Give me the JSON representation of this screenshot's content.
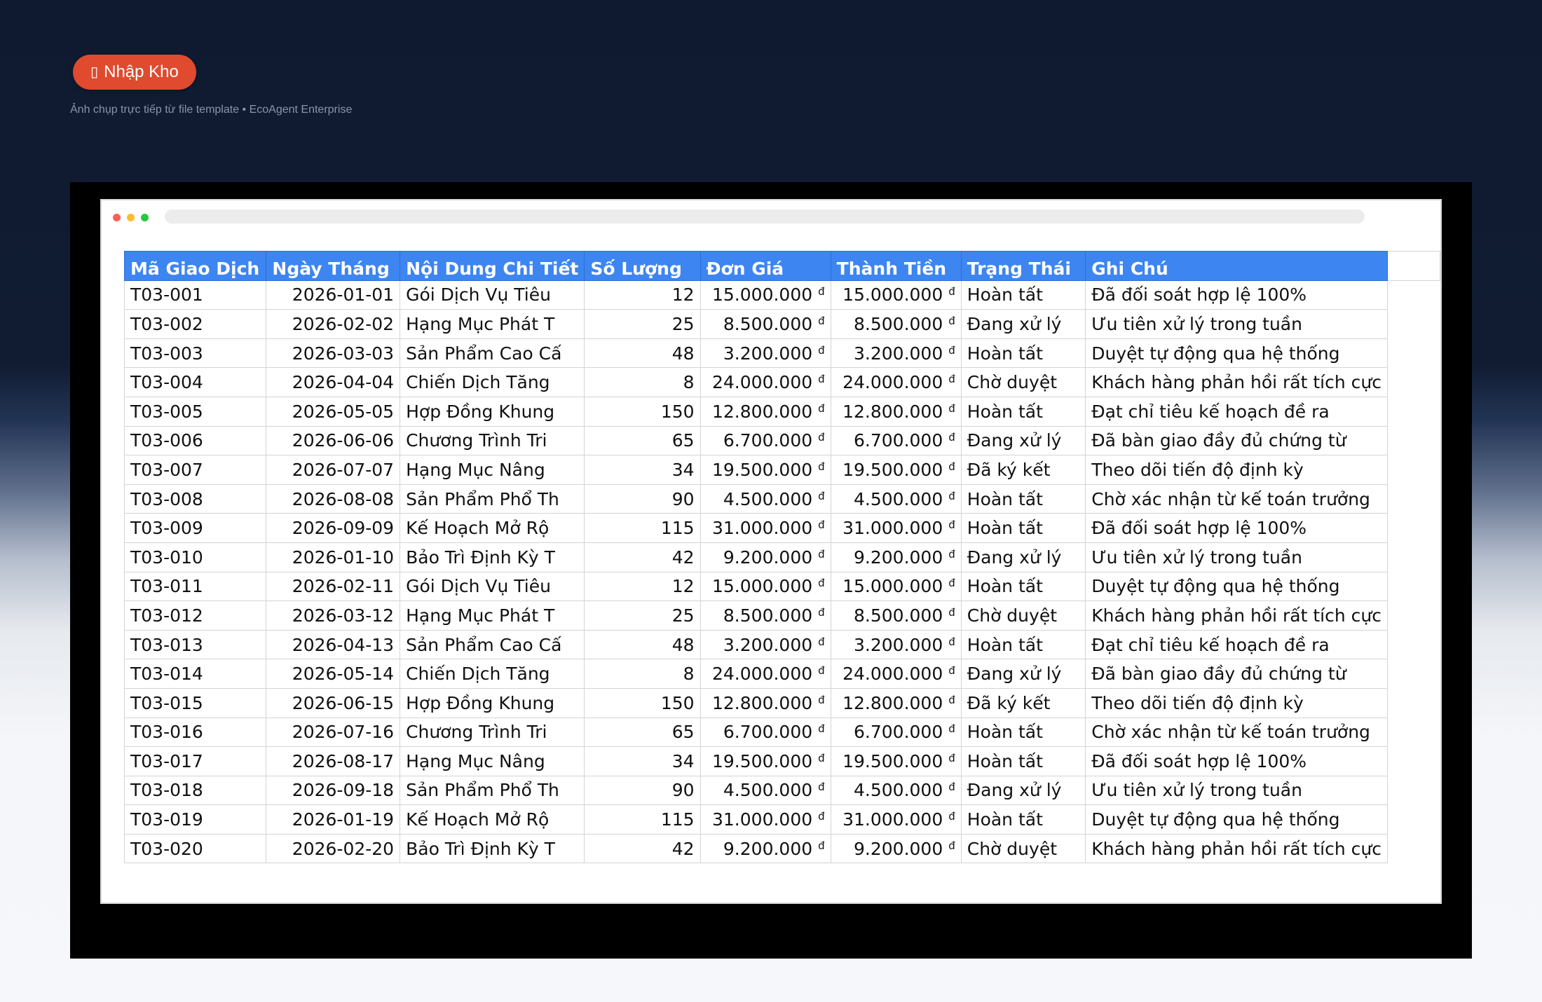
{
  "badge": {
    "icon": "▯",
    "label": "Nhập Kho"
  },
  "caption": "Ảnh chụp trực tiếp từ file template • EcoAgent Enterprise",
  "colors": {
    "badge": "#e04a2f",
    "header": "#3d85f0",
    "dot_red": "#ff5f57",
    "dot_yellow": "#febc2e",
    "dot_green": "#28c840"
  },
  "table": {
    "headers": [
      "Mã Giao Dịch",
      "Ngày Tháng",
      "Nội Dung Chi Tiết",
      "Số Lượng",
      "Đơn Giá",
      "Thành Tiền",
      "Trạng Thái",
      "Ghi Chú"
    ],
    "currency": "đ",
    "rows": [
      [
        "T03-001",
        "2026-01-01",
        "Gói Dịch Vụ Tiêu",
        "12",
        "15.000.000",
        "15.000.000",
        "Hoàn tất",
        "Đã đối soát hợp lệ 100%"
      ],
      [
        "T03-002",
        "2026-02-02",
        "Hạng Mục Phát T",
        "25",
        "8.500.000",
        "8.500.000",
        "Đang xử lý",
        "Ưu tiên xử lý trong tuần"
      ],
      [
        "T03-003",
        "2026-03-03",
        "Sản Phẩm Cao Cấ",
        "48",
        "3.200.000",
        "3.200.000",
        "Hoàn tất",
        "Duyệt tự động qua hệ thống"
      ],
      [
        "T03-004",
        "2026-04-04",
        "Chiến Dịch Tăng",
        "8",
        "24.000.000",
        "24.000.000",
        "Chờ duyệt",
        "Khách hàng phản hồi rất tích cực"
      ],
      [
        "T03-005",
        "2026-05-05",
        "Hợp Đồng Khung",
        "150",
        "12.800.000",
        "12.800.000",
        "Hoàn tất",
        "Đạt chỉ tiêu kế hoạch đề ra"
      ],
      [
        "T03-006",
        "2026-06-06",
        "Chương Trình Tri",
        "65",
        "6.700.000",
        "6.700.000",
        "Đang xử lý",
        "Đã bàn giao đầy đủ chứng từ"
      ],
      [
        "T03-007",
        "2026-07-07",
        "Hạng Mục Nâng",
        "34",
        "19.500.000",
        "19.500.000",
        "Đã ký kết",
        "Theo dõi tiến độ định kỳ"
      ],
      [
        "T03-008",
        "2026-08-08",
        "Sản Phẩm Phổ Th",
        "90",
        "4.500.000",
        "4.500.000",
        "Hoàn tất",
        "Chờ xác nhận từ kế toán trưởng"
      ],
      [
        "T03-009",
        "2026-09-09",
        "Kế Hoạch Mở Rộ",
        "115",
        "31.000.000",
        "31.000.000",
        "Hoàn tất",
        "Đã đối soát hợp lệ 100%"
      ],
      [
        "T03-010",
        "2026-01-10",
        "Bảo Trì Định Kỳ T",
        "42",
        "9.200.000",
        "9.200.000",
        "Đang xử lý",
        "Ưu tiên xử lý trong tuần"
      ],
      [
        "T03-011",
        "2026-02-11",
        "Gói Dịch Vụ Tiêu",
        "12",
        "15.000.000",
        "15.000.000",
        "Hoàn tất",
        "Duyệt tự động qua hệ thống"
      ],
      [
        "T03-012",
        "2026-03-12",
        "Hạng Mục Phát T",
        "25",
        "8.500.000",
        "8.500.000",
        "Chờ duyệt",
        "Khách hàng phản hồi rất tích cực"
      ],
      [
        "T03-013",
        "2026-04-13",
        "Sản Phẩm Cao Cấ",
        "48",
        "3.200.000",
        "3.200.000",
        "Hoàn tất",
        "Đạt chỉ tiêu kế hoạch đề ra"
      ],
      [
        "T03-014",
        "2026-05-14",
        "Chiến Dịch Tăng",
        "8",
        "24.000.000",
        "24.000.000",
        "Đang xử lý",
        "Đã bàn giao đầy đủ chứng từ"
      ],
      [
        "T03-015",
        "2026-06-15",
        "Hợp Đồng Khung",
        "150",
        "12.800.000",
        "12.800.000",
        "Đã ký kết",
        "Theo dõi tiến độ định kỳ"
      ],
      [
        "T03-016",
        "2026-07-16",
        "Chương Trình Tri",
        "65",
        "6.700.000",
        "6.700.000",
        "Hoàn tất",
        "Chờ xác nhận từ kế toán trưởng"
      ],
      [
        "T03-017",
        "2026-08-17",
        "Hạng Mục Nâng",
        "34",
        "19.500.000",
        "19.500.000",
        "Hoàn tất",
        "Đã đối soát hợp lệ 100%"
      ],
      [
        "T03-018",
        "2026-09-18",
        "Sản Phẩm Phổ Th",
        "90",
        "4.500.000",
        "4.500.000",
        "Đang xử lý",
        "Ưu tiên xử lý trong tuần"
      ],
      [
        "T03-019",
        "2026-01-19",
        "Kế Hoạch Mở Rộ",
        "115",
        "31.000.000",
        "31.000.000",
        "Hoàn tất",
        "Duyệt tự động qua hệ thống"
      ],
      [
        "T03-020",
        "2026-02-20",
        "Bảo Trì Định Kỳ T",
        "42",
        "9.200.000",
        "9.200.000",
        "Chờ duyệt",
        "Khách hàng phản hồi rất tích cực"
      ]
    ]
  }
}
